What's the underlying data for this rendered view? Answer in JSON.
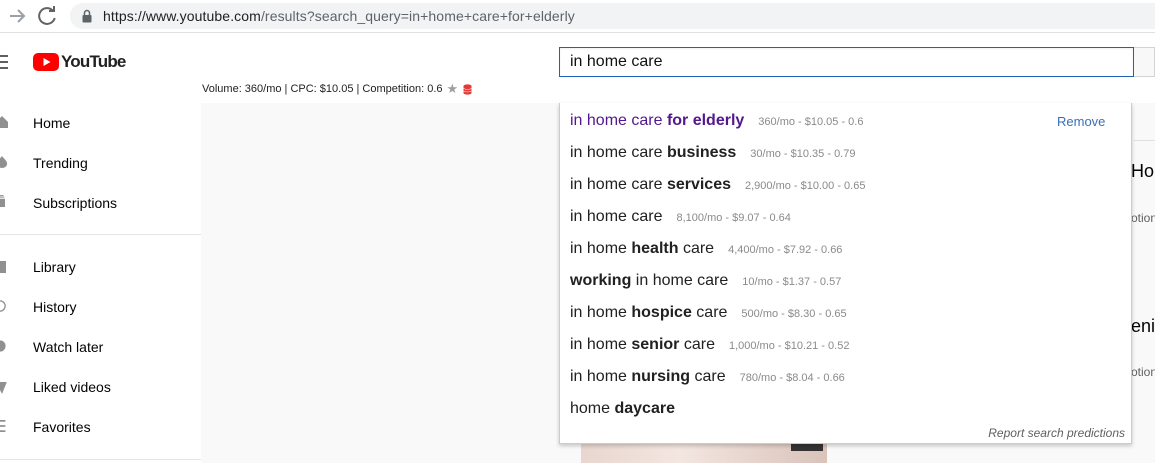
{
  "browser": {
    "url_prefix": "https://www.youtube.com",
    "url_rest": "/results?search_query=in+home+care+for+elderly"
  },
  "header": {
    "logo_text": "YouTube",
    "search_value": "in home care",
    "metrics": "Volume: 360/mo | CPC: $10.05 | Competition: 0.6"
  },
  "sidebar": {
    "items": [
      {
        "label": "Home",
        "icon": "home-icon"
      },
      {
        "label": "Trending",
        "icon": "trending-icon"
      },
      {
        "label": "Subscriptions",
        "icon": "subscriptions-icon"
      },
      {
        "label": "Library",
        "icon": "library-icon"
      },
      {
        "label": "History",
        "icon": "history-icon"
      },
      {
        "label": "Watch later",
        "icon": "watch-later-icon"
      },
      {
        "label": "Liked videos",
        "icon": "liked-videos-icon"
      },
      {
        "label": "Favorites",
        "icon": "favorites-icon"
      }
    ]
  },
  "suggestions": {
    "remove_label": "Remove",
    "report_label": "Report search predictions",
    "items": [
      {
        "base": "in home care ",
        "bold": "for elderly",
        "suffix": "",
        "stat": "360/mo - $10.05 - 0.6"
      },
      {
        "base": "in home care ",
        "bold": "business",
        "suffix": "",
        "stat": "30/mo - $10.35 - 0.79"
      },
      {
        "base": "in home care ",
        "bold": "services",
        "suffix": "",
        "stat": "2,900/mo - $10.00 - 0.65"
      },
      {
        "base": "in home care",
        "bold": "",
        "suffix": "",
        "stat": "8,100/mo - $9.07 - 0.64"
      },
      {
        "base": "in home ",
        "bold": "health",
        "suffix": " care",
        "stat": "4,400/mo - $7.92 - 0.66"
      },
      {
        "base": "",
        "bold": "working",
        "suffix": " in home care",
        "stat": "10/mo - $1.37 - 0.57"
      },
      {
        "base": "in home ",
        "bold": "hospice",
        "suffix": " care",
        "stat": "500/mo - $8.30 - 0.65"
      },
      {
        "base": "in home ",
        "bold": "senior",
        "suffix": " care",
        "stat": "1,000/mo - $10.21 - 0.52"
      },
      {
        "base": "in home ",
        "bold": "nursing",
        "suffix": " care",
        "stat": "780/mo - $8.04 - 0.66"
      },
      {
        "base": "home ",
        "bold": "daycare",
        "suffix": "",
        "stat": ""
      }
    ]
  },
  "background": {
    "title_1": "Ho",
    "sub_1": "otion",
    "title_2": "enio",
    "sub_2": "otion"
  },
  "colors": {
    "visited": "#52188c",
    "link": "#3a6fb7",
    "youtube_red": "#ff0000"
  }
}
